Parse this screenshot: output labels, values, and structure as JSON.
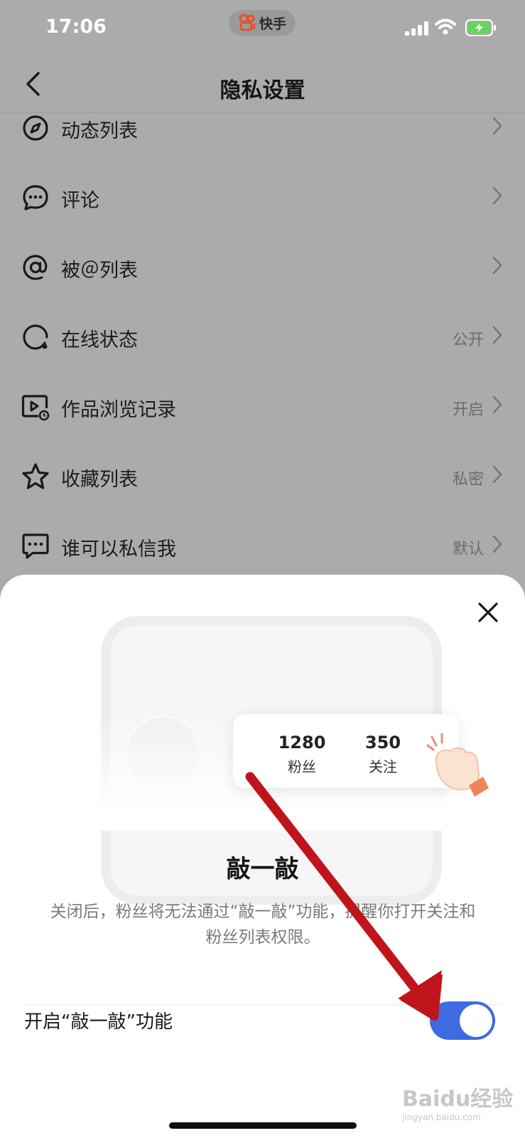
{
  "status_bar": {
    "time": "17:06",
    "app_name": "快手"
  },
  "nav": {
    "title": "隐私设置"
  },
  "settings": [
    {
      "label": "动态列表",
      "value": "",
      "icon": "compass-icon"
    },
    {
      "label": "评论",
      "value": "",
      "icon": "comment-icon"
    },
    {
      "label": "被＠列表",
      "value": "",
      "icon": "at-icon"
    },
    {
      "label": "在线状态",
      "value": "公开",
      "icon": "online-status-icon"
    },
    {
      "label": "作品浏览记录",
      "value": "开启",
      "icon": "play-history-icon"
    },
    {
      "label": "收藏列表",
      "value": "私密",
      "icon": "star-icon"
    },
    {
      "label": "谁可以私信我",
      "value": "默认",
      "icon": "message-icon"
    }
  ],
  "sheet": {
    "stats": [
      {
        "number": "1280",
        "label": "粉丝"
      },
      {
        "number": "350",
        "label": "关注"
      }
    ],
    "heading": "敲一敲",
    "description": "关闭后，粉丝将无法通过“敲一敲”功能，提醒你打开关注和粉丝列表权限。",
    "toggle_label": "开启“敲一敲”功能",
    "toggle_on": true
  },
  "watermark": {
    "brand": "Baidu经验",
    "url": "jingyan.baidu.com"
  },
  "colors": {
    "accent": "#3e6be0",
    "overlay": "#ababab",
    "arrow": "#c0141c"
  }
}
